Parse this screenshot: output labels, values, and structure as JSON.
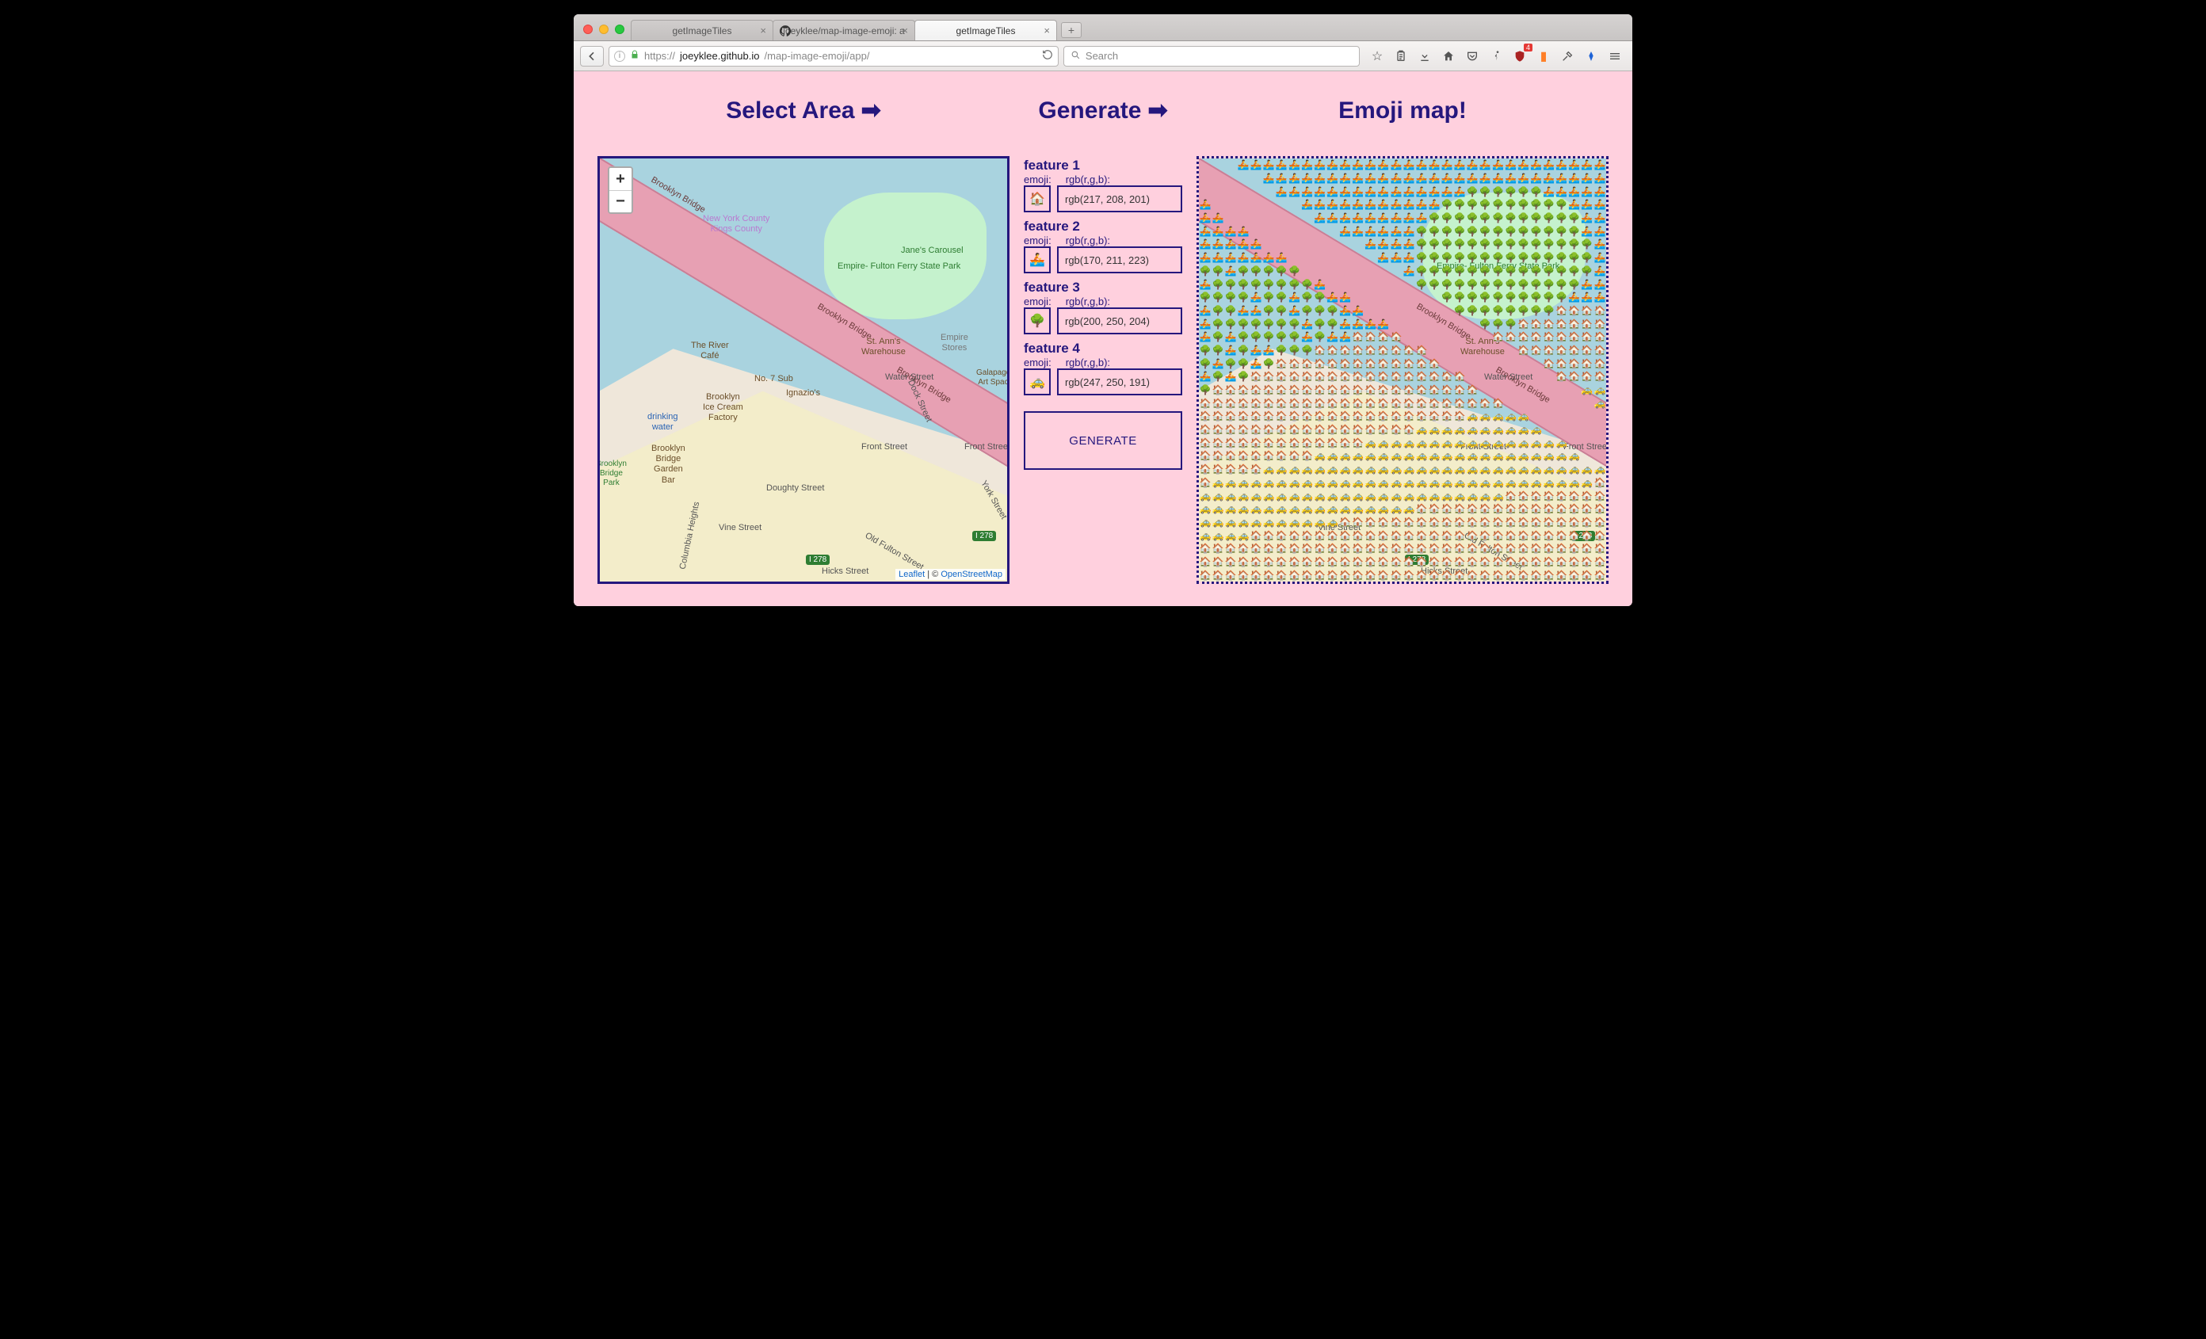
{
  "browser": {
    "tabs": [
      {
        "title": "getImageTiles",
        "active": false,
        "favicon": ""
      },
      {
        "title": "joeyklee/map-image-emoji: a",
        "active": false,
        "favicon": "github"
      },
      {
        "title": "getImageTiles",
        "active": true,
        "favicon": ""
      }
    ],
    "url_host": "joeyklee.github.io",
    "url_scheme": "https://",
    "url_path": "/map-image-emoji/app/",
    "search_placeholder": "Search",
    "badge_count": "4"
  },
  "headings": {
    "select": "Select Area",
    "generate": "Generate",
    "result": "Emoji map!"
  },
  "map": {
    "zoom_in": "+",
    "zoom_out": "−",
    "attribution_leaflet": "Leaflet",
    "attribution_sep": " | © ",
    "attribution_osm": "OpenStreetMap",
    "bridge_label": "Brooklyn Bridge",
    "streets": {
      "water_st": "Water Street",
      "front_st": "Front Street",
      "doughty": "Doughty Street",
      "vine": "Vine Street",
      "hicks": "Hicks Street",
      "columbia": "Columbia Heights",
      "dock": "Dock Street",
      "old_fulton": "Old Fulton Street",
      "york": "York Street"
    },
    "parks": {
      "empire": "Empire-\nFulton\nFerry State\nPark",
      "janes": "Jane's\nCarousel"
    },
    "pois": {
      "river_cafe": "The River\nCafé",
      "ice_cream": "Brooklyn\nIce Cream\nFactory",
      "drinking": "drinking\nwater",
      "garden_bar": "Brooklyn\nBridge\nGarden\nBar",
      "no7": "No. 7 Sub",
      "ignazio": "Ignazio's",
      "stann": "St. Ann's\nWarehouse",
      "empire_stores": "Empire\nStores",
      "galapagos": "Galapagos\nArt Space",
      "bklyn_park": "Brooklyn\nBridge\nPark"
    },
    "county_border": "New York County\nKings County",
    "shields": {
      "i278": "I 278"
    }
  },
  "features_header_emoji": "emoji:",
  "features_header_rgb": "rgb(r,g,b):",
  "features": [
    {
      "title": "feature 1",
      "emoji": "🏠",
      "rgb": "rgb(217, 208, 201)"
    },
    {
      "title": "feature 2",
      "emoji": "🚣",
      "rgb": "rgb(170, 211, 223)"
    },
    {
      "title": "feature 3",
      "emoji": "🌳",
      "rgb": "rgb(200, 250, 204)"
    },
    {
      "title": "feature 4",
      "emoji": "🚕",
      "rgb": "rgb(247, 250, 191)"
    }
  ],
  "generate_button": "GENERATE"
}
